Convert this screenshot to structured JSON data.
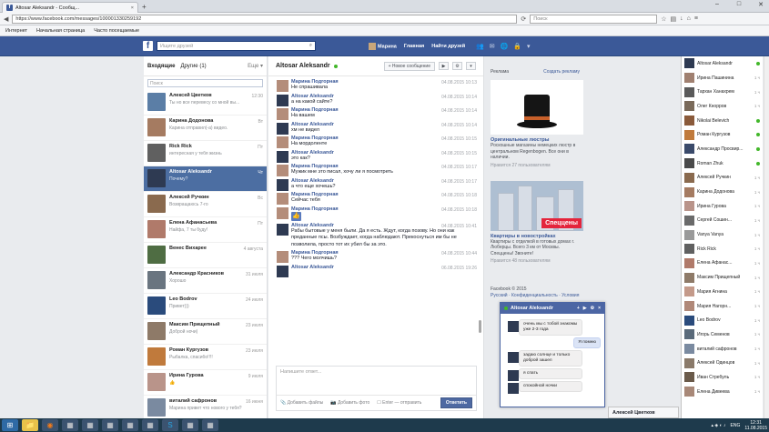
{
  "browser": {
    "tab_title": "Altosar Aleksandr - Сообщ...",
    "url": "https://www.facebook.com/messages/100001330259192",
    "search_placeholder": "Поиск",
    "bookmarks": [
      "Интернет",
      "Начальная страница",
      "Часто посещаемые"
    ]
  },
  "fb": {
    "logo": "f",
    "search_placeholder": "Ищите друзей",
    "nav": [
      "Марина",
      "Главная",
      "Найти друзей"
    ]
  },
  "inbox": {
    "tab_inbox": "Входящие",
    "tab_other": "Другие (1)",
    "more": "Еще ▾",
    "search_placeholder": "Поиск",
    "conversations": [
      {
        "name": "Алексей Цветков",
        "preview": "Ты но все перевесу со мной вы...",
        "time": "12:30",
        "color": "#5b7ea6"
      },
      {
        "name": "Карина Додонова",
        "preview": "Карина отправил(-а) видео.",
        "time": "Вт",
        "color": "#a57b61"
      },
      {
        "name": "Rick Rick",
        "preview": "интересная у тебя жизнь",
        "time": "Пт",
        "color": "#606060"
      },
      {
        "name": "Altosar Aleksandr",
        "preview": "Почему?",
        "time": "Чт",
        "color": "#2e3a52"
      },
      {
        "name": "Алексей Ручкин",
        "preview": "Возвращаюсь 7-го",
        "time": "Вс",
        "color": "#8a6a4e"
      },
      {
        "name": "Елена Афанасьева",
        "preview": "Найфа, 7 ты буду!",
        "time": "Пт",
        "color": "#b07a6a"
      },
      {
        "name": "Венес Вихарее",
        "preview": "",
        "time": "4 августа",
        "color": "#4f6d43"
      },
      {
        "name": "Александр Красников",
        "preview": "Хорошо",
        "time": "31 июля",
        "color": "#6a7580"
      },
      {
        "name": "Leo Bodrov",
        "preview": "Привет)))",
        "time": "24 июля",
        "color": "#2a4b7c"
      },
      {
        "name": "Максим Прищепный",
        "preview": "Доброй ночи)",
        "time": "23 июля",
        "color": "#8e7a68"
      },
      {
        "name": "Роман Кургузов",
        "preview": "Рыбалка, спасибо!!!!",
        "time": "23 июля",
        "color": "#c07a3c"
      },
      {
        "name": "Ирина Гурова",
        "preview": "👍",
        "time": "9 июля",
        "color": "#b9948a"
      },
      {
        "name": "виталий сафронов",
        "preview": "Марина привет что нового у тебя?",
        "time": "16 июня",
        "color": "#7a8aa0"
      }
    ]
  },
  "thread": {
    "title": "Altosar Aleksandr",
    "new_message": "+ Новое сообщение",
    "messages": [
      {
        "sender": "Марина Подгорная",
        "text": "Не спрашивала",
        "time": "04.08.2015 10:13",
        "av": "#b48d7a"
      },
      {
        "sender": "Altosar Aleksandr",
        "text": "а на какой сайте?",
        "time": "04.08.2015 10:14",
        "av": "#2e3a52"
      },
      {
        "sender": "Марина Подгорная",
        "text": "На вашем",
        "time": "04.08.2015 10:14",
        "av": "#b48d7a"
      },
      {
        "sender": "Altosar Aleksandr",
        "text": "хм не видел",
        "time": "04.08.2015 10:14",
        "av": "#2e3a52"
      },
      {
        "sender": "Марина Подгорная",
        "text": "На мордоленте",
        "time": "04.08.2015 10:15",
        "av": "#b48d7a"
      },
      {
        "sender": "Altosar Aleksandr",
        "text": "это как?",
        "time": "04.08.2015 10:15",
        "av": "#2e3a52"
      },
      {
        "sender": "Марина Подгорная",
        "text": "Мужик мне это писал, хочу ли я посмотреть",
        "time": "04.08.2015 10:17",
        "av": "#b48d7a"
      },
      {
        "sender": "Altosar Aleksandr",
        "text": "а что еще хочешь?",
        "time": "04.08.2015 10:17",
        "av": "#2e3a52"
      },
      {
        "sender": "Марина Подгорная",
        "text": "Сейчас тебя",
        "time": "04.08.2015 10:18",
        "av": "#b48d7a"
      },
      {
        "sender": "Марина Подгорная",
        "text": "",
        "like": true,
        "time": "04.08.2015 10:18",
        "av": "#b48d7a"
      },
      {
        "sender": "Altosar Aleksandr",
        "text": "Рабы бытовые у меня были. Да я есть. Ждут, когда позову. Но они как преданные псы. Возбуждает, когда наблюдают. Прекоснуться им бы не позволила, просто тот их убил бы за это.",
        "time": "04.08.2015 10:41",
        "av": "#2e3a52"
      },
      {
        "sender": "Марина Подгорная",
        "text": "??? Чего молчишь?",
        "time": "04.08.2015 10:44",
        "av": "#b48d7a"
      },
      {
        "sender": "Altosar Aleksandr",
        "text": "",
        "time": "06.08.2015 19:26",
        "av": "#2e3a52"
      }
    ],
    "composer_placeholder": "Напишите ответ...",
    "add_files": "Добавить файлы",
    "add_photo": "Добавить фото",
    "enter_hint": "Enter — отправить",
    "send": "Ответить"
  },
  "ads": {
    "header": "Реклама",
    "create": "Создать рекламу",
    "ad1_title": "Оригинальные люстры",
    "ad1_text": "Роскошные магазины немецких люстр в центральном Regenbogen. Все они в наличии.",
    "ad1_likes": "Нравится 27 пользователям",
    "ad2_badge": "Спеццены",
    "ad2_title": "Квартиры в новостройках",
    "ad2_text": "Квартиры с отделкой в готовых домах г. Люберцы. Всего 3 км от Москвы. Спеццены! Звоните!",
    "ad2_likes": "Нравится 48 пользователям",
    "footer1": "Facebook © 2015",
    "footer2": "Русский · Конфиденциальность · Условия"
  },
  "chat_list": [
    {
      "name": "Altosar Aleksandr",
      "status": "dot",
      "color": "#2e3a52"
    },
    {
      "name": "Ирина Пашинина",
      "status": "1 ч",
      "color": "#a08070"
    },
    {
      "name": "Тархан Ханахрем",
      "status": "1 ч",
      "color": "#5a5a5a"
    },
    {
      "name": "Олег Кнорров",
      "status": "1 ч",
      "color": "#7a6a5a"
    },
    {
      "name": "Nikolai Belevich",
      "status": "dot",
      "color": "#8a5a3a"
    },
    {
      "name": "Роман Кургузов",
      "status": "dot",
      "color": "#c07a3c"
    },
    {
      "name": "Александр Просвир...",
      "status": "dot",
      "color": "#3a4a6a"
    },
    {
      "name": "Roman Zhuk",
      "status": "dot",
      "color": "#4a4a4a"
    },
    {
      "name": "Алексей Ручкин",
      "status": "1 ч",
      "color": "#8a6a4e"
    },
    {
      "name": "Карина Додонова",
      "status": "1 ч",
      "color": "#a57b61"
    },
    {
      "name": "Ирина Гурова",
      "status": "1 ч",
      "color": "#b9948a"
    },
    {
      "name": "Сергей Сошин...",
      "status": "1 ч",
      "color": "#6a6a6a"
    },
    {
      "name": "Vanya Vanya",
      "status": "1 ч",
      "color": "#9a9a9a"
    },
    {
      "name": "Rick Rick",
      "status": "1 ч",
      "color": "#606060"
    },
    {
      "name": "Елена Афанас...",
      "status": "1 ч",
      "color": "#b07a6a"
    },
    {
      "name": "Максим Прищепный",
      "status": "1 ч",
      "color": "#8e7a68"
    },
    {
      "name": "Мария Агнина",
      "status": "1 ч",
      "color": "#c49a8a"
    },
    {
      "name": "Мария Нагорн...",
      "status": "1 ч",
      "color": "#b08878"
    },
    {
      "name": "Leo Bodrov",
      "status": "1 ч",
      "color": "#2a4b7c"
    },
    {
      "name": "Игорь Семенов",
      "status": "1 ч",
      "color": "#5a6a7a"
    },
    {
      "name": "виталий сафронов",
      "status": "1 ч",
      "color": "#7a8aa0"
    },
    {
      "name": "Алексей Одинцов",
      "status": "1 ч",
      "color": "#8a7a6a"
    },
    {
      "name": "Иван Стребуль",
      "status": "1 ч",
      "color": "#6a5a4a"
    },
    {
      "name": "Елена Дивеева",
      "status": "1 ч",
      "color": "#a88878"
    }
  ],
  "popup": {
    "title": "Altosar Aleksandr",
    "messages": [
      {
        "dir": "in",
        "text": "очень мы с тобой знакомы уже 2-3 года"
      },
      {
        "dir": "out",
        "text": "Я помню"
      },
      {
        "dir": "in",
        "text": "задаю солнце и только доброй зашел"
      },
      {
        "dir": "in",
        "text": "я спать"
      },
      {
        "dir": "in",
        "text": "спокойной ночки"
      }
    ]
  },
  "mini_chat": "Алексей Цветков",
  "tray": {
    "lang": "ENG",
    "time": "12:31",
    "date": "11.08.2015"
  },
  "colors": {
    "fb_blue": "#3b5998",
    "selected": "#4c6ea2",
    "online": "#42b72a"
  }
}
